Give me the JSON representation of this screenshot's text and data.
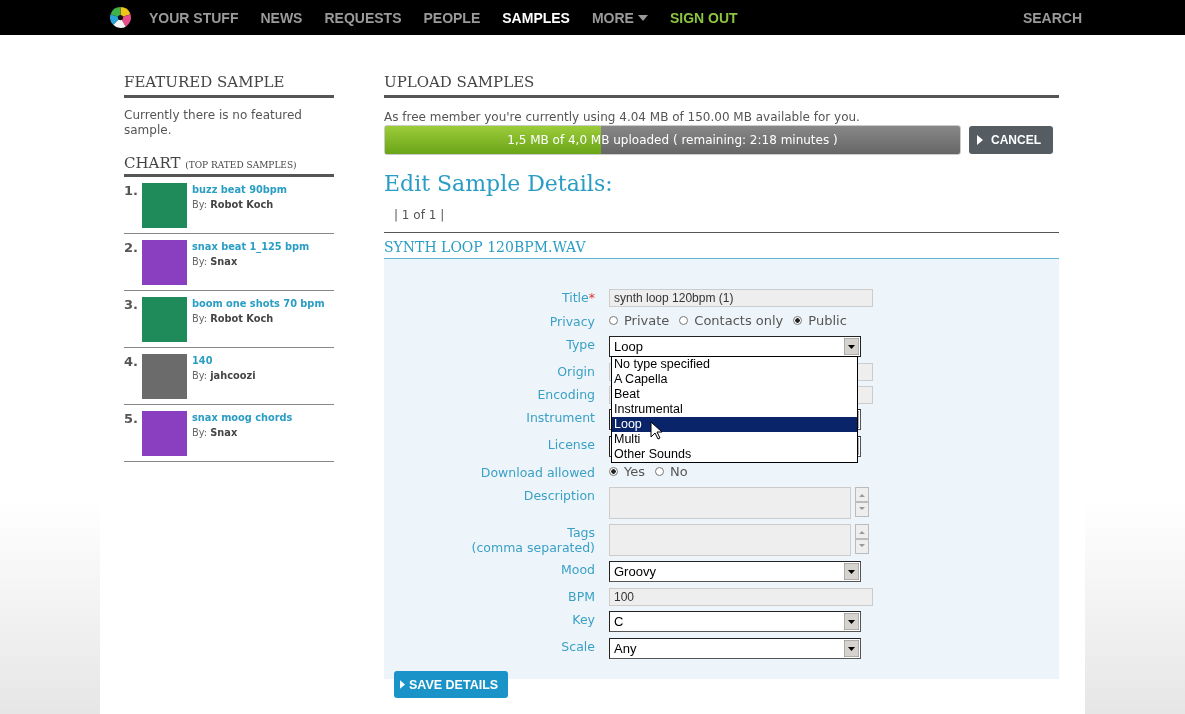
{
  "nav": {
    "items": [
      {
        "label": "YOUR STUFF",
        "selected": false,
        "kind": "link"
      },
      {
        "label": "NEWS",
        "selected": false,
        "kind": "link"
      },
      {
        "label": "REQUESTS",
        "selected": false,
        "kind": "link"
      },
      {
        "label": "PEOPLE",
        "selected": false,
        "kind": "link"
      },
      {
        "label": "SAMPLES",
        "selected": true,
        "kind": "link"
      },
      {
        "label": "MORE",
        "selected": false,
        "kind": "menu"
      },
      {
        "label": "SIGN OUT",
        "selected": false,
        "kind": "signout"
      }
    ],
    "search": "SEARCH"
  },
  "sidebar": {
    "featured_title": "FEATURED SAMPLE",
    "featured_text": "Currently there is no featured sample.",
    "chart_title": "CHART",
    "chart_subtitle": "(TOP RATED SAMPLES)",
    "chart": [
      {
        "rank": "1.",
        "title": "buzz beat 90bpm",
        "by": "By:",
        "author": "Robot Koch",
        "color": "#1f8a5a"
      },
      {
        "rank": "2.",
        "title": "snax beat 1_125 bpm",
        "by": "By:",
        "author": "Snax",
        "color": "#8a3fc0"
      },
      {
        "rank": "3.",
        "title": "boom one shots 70 bpm",
        "by": "By:",
        "author": "Robot Koch",
        "color": "#1f8a5a"
      },
      {
        "rank": "4.",
        "title": "140",
        "by": "By:",
        "author": "jahcoozi",
        "color": "#6b6b6b"
      },
      {
        "rank": "5.",
        "title": "snax moog chords",
        "by": "By:",
        "author": "Snax",
        "color": "#8a3fc0"
      }
    ]
  },
  "upload": {
    "title": "UPLOAD SAMPLES",
    "usage": "As free member you're currently using 4.04 MB of 150.00 MB available for you.",
    "progress_text": "1,5 MB of 4,0 MB uploaded ( remaining: 2:18 minutes )",
    "level": 0.375,
    "cancel": "CANCEL"
  },
  "edit": {
    "title": "Edit Sample Details:",
    "pager": "| 1 of 1 |",
    "file": "SYNTH LOOP 120BPM.WAV",
    "fields": [
      {
        "kind": "text",
        "label": "Title",
        "required": true,
        "required_mark": "*",
        "value": "synth loop 120bpm (1)"
      },
      {
        "kind": "radios",
        "label": "Privacy",
        "options": [
          {
            "label": "Private",
            "selected": false
          },
          {
            "label": "Contacts only",
            "selected": false
          },
          {
            "label": "Public",
            "selected": true
          }
        ]
      },
      {
        "kind": "select",
        "label": "Type",
        "value": "Loop",
        "open": true,
        "options": [
          {
            "label": "No type specified",
            "selected": false
          },
          {
            "label": "A Capella",
            "selected": false
          },
          {
            "label": "Beat",
            "selected": false
          },
          {
            "label": "Instrumental",
            "selected": false
          },
          {
            "label": "Loop",
            "selected": true
          },
          {
            "label": "Multi",
            "selected": false
          },
          {
            "label": "Other Sounds",
            "selected": false
          }
        ]
      },
      {
        "kind": "text",
        "label": "Origin"
      },
      {
        "kind": "text",
        "label": "Encoding"
      },
      {
        "kind": "select",
        "label": "Instrument"
      },
      {
        "kind": "select",
        "label": "License"
      },
      {
        "kind": "radios",
        "label": "Download allowed",
        "options": [
          {
            "label": "Yes",
            "selected": true
          },
          {
            "label": "No",
            "selected": false
          }
        ]
      },
      {
        "kind": "textarea",
        "label": "Description"
      },
      {
        "kind": "textarea",
        "label": "Tags",
        "sublabel": "(comma separated)"
      },
      {
        "kind": "select",
        "label": "Mood",
        "value": "Groovy"
      },
      {
        "kind": "text",
        "label": "BPM",
        "value": "100"
      },
      {
        "kind": "select",
        "label": "Key",
        "value": "C"
      },
      {
        "kind": "select",
        "label": "Scale",
        "value": "Any"
      }
    ],
    "save": "SAVE DETAILS"
  }
}
